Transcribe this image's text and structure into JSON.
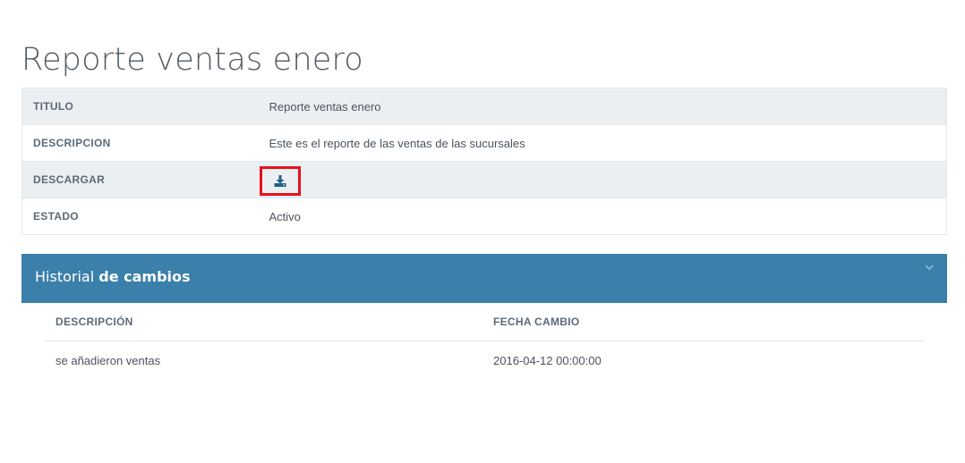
{
  "page": {
    "title": "Reporte ventas enero"
  },
  "details": {
    "rows": [
      {
        "label": "TITULO",
        "value": "Reporte ventas enero"
      },
      {
        "label": "DESCRIPCION",
        "value": "Este es el reporte de las ventas de las sucursales"
      },
      {
        "label": "DESCARGAR",
        "value": ""
      },
      {
        "label": "ESTADO",
        "value": "Activo"
      }
    ],
    "download_icon": "download-icon"
  },
  "history_panel": {
    "title_light": "Historial ",
    "title_bold": "de cambios",
    "toggle_icon": "chevron-down-icon",
    "columns": [
      "DESCRIPCIÓN",
      "FECHA CAMBIO"
    ],
    "rows": [
      {
        "descripcion": "se añadieron ventas",
        "fecha": "2016-04-12 00:00:00"
      }
    ]
  },
  "colors": {
    "panel_header": "#3a80aa",
    "highlight_border": "#e8111b",
    "icon": "#1f5f8b"
  }
}
